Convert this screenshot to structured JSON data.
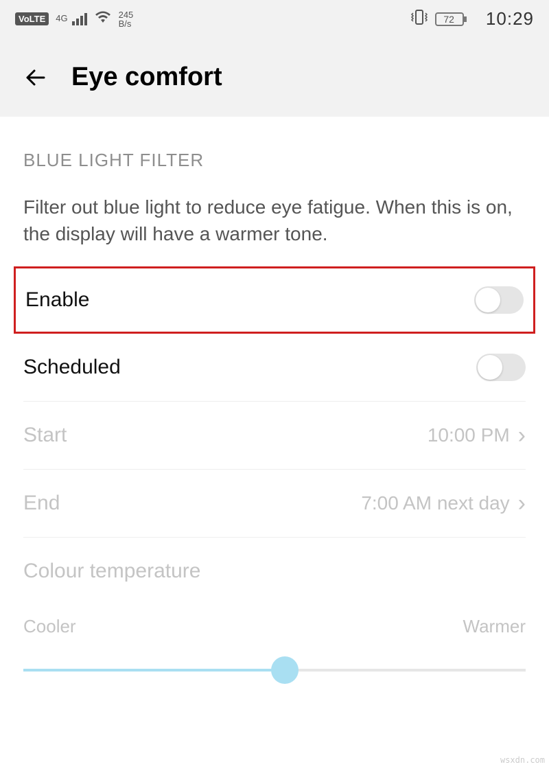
{
  "status": {
    "volte": "VoLTE",
    "network_gen": "4G",
    "speed_top": "245",
    "speed_bottom": "B/s",
    "battery_pct": "72",
    "time": "10:29"
  },
  "header": {
    "title": "Eye comfort"
  },
  "section": {
    "heading": "BLUE LIGHT FILTER",
    "description": "Filter out blue light to reduce eye fatigue. When this is on, the display will have a warmer tone."
  },
  "rows": {
    "enable": {
      "label": "Enable",
      "on": false
    },
    "scheduled": {
      "label": "Scheduled",
      "on": false
    },
    "start": {
      "label": "Start",
      "value": "10:00 PM"
    },
    "end": {
      "label": "End",
      "value": "7:00 AM next day"
    }
  },
  "temperature": {
    "title": "Colour temperature",
    "left": "Cooler",
    "right": "Warmer",
    "percent": 52
  },
  "watermark": "wsxdn.com"
}
